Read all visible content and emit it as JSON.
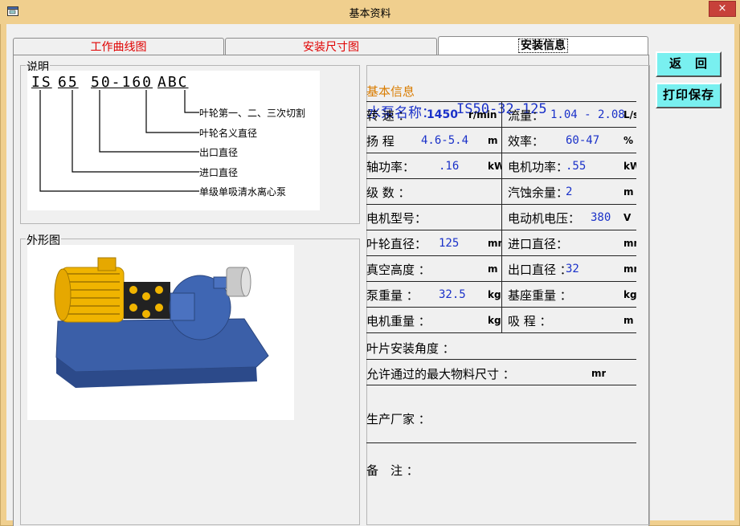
{
  "window": {
    "title": "基本资料",
    "close": "×"
  },
  "tabs": [
    "工作曲线图",
    "安装尺寸图",
    "安装信息"
  ],
  "buttons": {
    "back": "返　回",
    "print": "打印保存"
  },
  "explain": {
    "group": "说明",
    "codes": [
      "IS",
      "65",
      "50-160",
      "ABC"
    ],
    "items": [
      "叶轮第一、二、三次切割",
      "叶轮名义直径",
      "出口直径",
      "进口直径",
      "单级单吸清水离心泵"
    ]
  },
  "appearance": {
    "group": "外形图"
  },
  "info": {
    "group": "基本信息",
    "pump_name_label": "水泵名称：",
    "pump_name_value": "IS50-32-125",
    "rows": [
      {
        "l1": "转 速 ：",
        "v1": "1450",
        "u1": "r/min",
        "l2": "流量：",
        "v2": "1.04 - 2.08",
        "u2": "L/s"
      },
      {
        "l1": "扬 程",
        "v1": "4.6-5.4",
        "u1": "m",
        "l2": "效率：",
        "v2": "60-47",
        "u2": "%"
      },
      {
        "l1": "轴功率：",
        "v1": ".16",
        "u1": "kW",
        "l2": "电机功率：",
        "v2": ".55",
        "u2": "kW"
      },
      {
        "l1": "级 数 ：",
        "v1": "",
        "u1": "",
        "l2": "汽蚀余量：",
        "v2": "2",
        "u2": "m"
      },
      {
        "l1": "电机型号：",
        "v1": "",
        "u1": "",
        "l2": "电动机电压：",
        "v2": "380",
        "u2": "V"
      },
      {
        "l1": "叶轮直径：",
        "v1": "125",
        "u1": "mm",
        "l2": "进口直径：",
        "v2": "",
        "u2": "mm"
      },
      {
        "l1": "真空高度 ：",
        "v1": "",
        "u1": "m",
        "l2": "出口直径 ：",
        "v2": "32",
        "u2": "mm"
      },
      {
        "l1": "泵重量 ：",
        "v1": "32.5",
        "u1": "kg",
        "l2": "基座重量 ：",
        "v2": "",
        "u2": "kg"
      },
      {
        "l1": "电机重量 ：",
        "v1": "",
        "u1": "kg",
        "l2": "吸 程 ：",
        "v2": "",
        "u2": "m"
      }
    ],
    "blade_angle": "叶片安装角度 ：",
    "max_particle": "允许通过的最大物料尺寸 ：",
    "max_particle_unit": "mr",
    "manufacturer": "生产厂家 ：",
    "remark": "备　注 ："
  }
}
